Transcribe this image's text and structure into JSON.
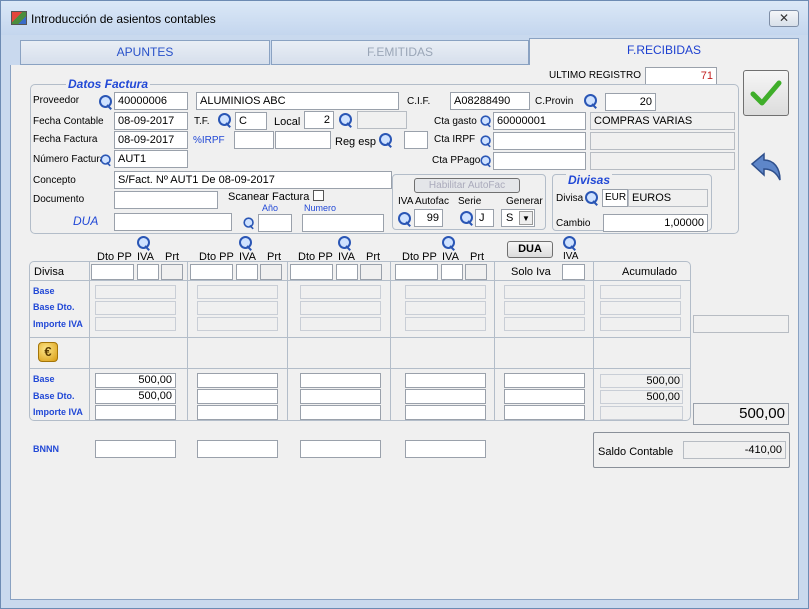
{
  "window": {
    "title": "Introducción de asientos contables",
    "close_glyph": "✕"
  },
  "tabs": [
    {
      "label": "APUNTES"
    },
    {
      "label": "F.EMITIDAS"
    },
    {
      "label": "F.RECIBIDAS"
    }
  ],
  "ultimo_registro": {
    "label": "ULTIMO REGISTRO",
    "value": "71"
  },
  "datos": {
    "title": "Datos Factura",
    "proveedor_label": "Proveedor",
    "proveedor_code": "40000006",
    "proveedor_name": "ALUMINIOS ABC",
    "cif_label": "C.I.F.",
    "cif": "A08288490",
    "cprovin_label": "C.Provin",
    "cprovin": "20",
    "fecha_contable_label": "Fecha Contable",
    "fecha_contable": "08-09-2017",
    "tf_label": "T.F.",
    "tf": "C",
    "local_label": "Local",
    "local": "2",
    "cta_gasto_label": "Cta gasto",
    "cta_gasto": "60000001",
    "cta_gasto_name": "COMPRAS VARIAS",
    "fecha_factura_label": "Fecha Factura",
    "fecha_factura": "08-09-2017",
    "pirpf_label": "%IRPF",
    "reg_esp_label": "Reg esp",
    "cta_irpf_label": "Cta  IRPF",
    "numero_factura_label": "Número Factura",
    "numero_factura": "AUT1",
    "cta_ppago_label": "Cta PPago",
    "concepto_label": "Concepto",
    "concepto": "S/Fact. Nº AUT1 De 08-09-2017",
    "documento_label": "Documento",
    "scanear_label": "Scanear Factura",
    "dua_label": "DUA",
    "ano_label": "Año",
    "numero_label": "Numero",
    "habilitar_label": "Habilitar AutoFac",
    "iva_autofac_label": "IVA Autofac",
    "iva_autofac": "99",
    "serie_label": "Serie",
    "serie": "J",
    "generar_label": "Generar",
    "generar": "S"
  },
  "divisas": {
    "title": "Divisas",
    "divisa_label": "Divisa",
    "divisa_code": "EUR",
    "divisa_name": "EUROS",
    "cambio_label": "Cambio",
    "cambio": "1,00000"
  },
  "grid": {
    "col_headers": {
      "dto_pp": "Dto PP",
      "iva": "IVA",
      "prt": "Prt"
    },
    "dua_button": "DUA",
    "iva_label": "IVA",
    "divisa_label": "Divisa",
    "solo_iva_label": "Solo Iva",
    "acumulado_label": "Acumulado",
    "rows1": [
      "Base",
      "Base Dto.",
      "Importe IVA"
    ],
    "rows2": [
      "Base",
      "Base Dto.",
      "Importe IVA"
    ],
    "base_value": "500,00",
    "base_dto_value": "500,00",
    "acum_base": "500,00",
    "acum_base_dto": "500,00",
    "total": "500,00",
    "bnnn_label": "BNNN",
    "saldo_label": "Saldo Contable",
    "saldo_value": "-410,00"
  },
  "colors": {
    "accent": "#2148d6",
    "red": "#c21f1f"
  }
}
